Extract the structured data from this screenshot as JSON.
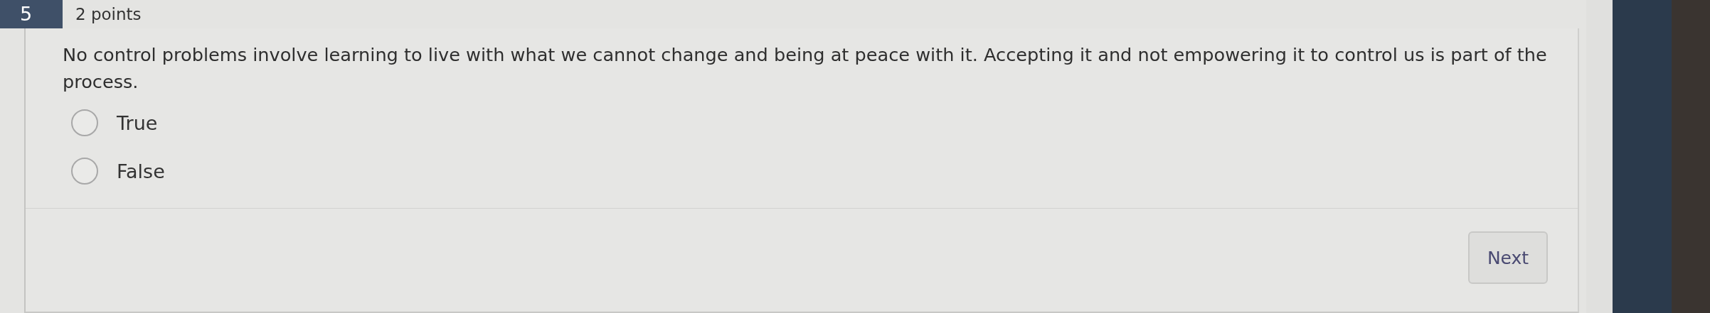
{
  "question": {
    "number": "5",
    "points": "2 points",
    "text": "No control problems involve learning to live with what we cannot change and being at peace with it. Accepting it and not empowering it to control us is part of the process.",
    "options": [
      {
        "label": "True",
        "selected": false
      },
      {
        "label": "False",
        "selected": false
      }
    ]
  },
  "buttons": [
    "Next"
  ]
}
